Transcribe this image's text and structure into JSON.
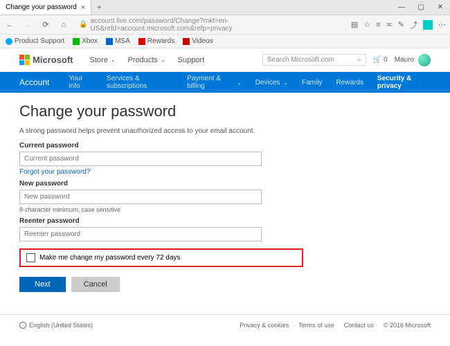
{
  "browser": {
    "tab_title": "Change your password",
    "url": "account.live.com/password/Change?mkt=en-US&refd=account.microsoft.com&refp=privacy",
    "favorites": [
      "Product Support",
      "Xbox",
      "MSA",
      "Rewards",
      "Videos"
    ]
  },
  "header": {
    "brand": "Microsoft",
    "nav": {
      "store": "Store",
      "products": "Products",
      "support": "Support"
    },
    "search_placeholder": "Search Microsoft.com",
    "cart_count": "0",
    "username": "Mauro"
  },
  "bluenav": {
    "account": "Account",
    "items": {
      "yourinfo": "Your info",
      "services": "Services & subscriptions",
      "payment": "Payment & billing",
      "devices": "Devices",
      "family": "Family",
      "rewards": "Rewards",
      "security": "Security & privacy"
    }
  },
  "form": {
    "title": "Change your password",
    "subtitle": "A strong password helps prevent unauthorized access to your email account.",
    "current_label": "Current password",
    "current_ph": "Current password",
    "forgot": "Forgot your password?",
    "new_label": "New password",
    "new_ph": "New password",
    "hint": "8-character minimum; case sensitive",
    "reenter_label": "Reenter password",
    "reenter_ph": "Reenter password",
    "checkbox_label": "Make me change my password every 72 days",
    "next": "Next",
    "cancel": "Cancel"
  },
  "footer": {
    "locale": "English (United States)",
    "links": {
      "privacy": "Privacy & cookies",
      "terms": "Terms of use",
      "contact": "Contact us"
    },
    "copyright": "© 2016 Microsoft"
  }
}
